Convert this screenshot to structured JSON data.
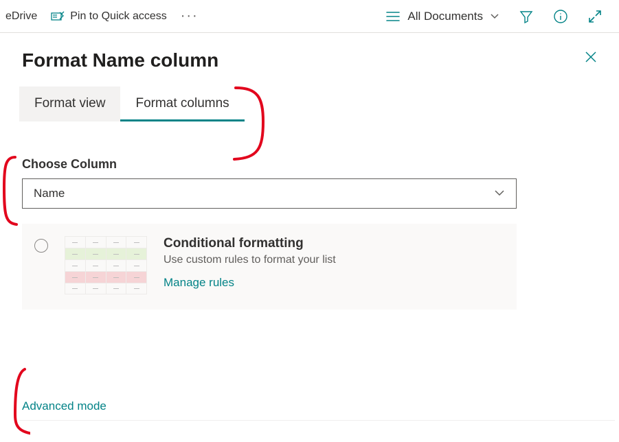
{
  "toolbar": {
    "edrive": "eDrive",
    "pin": "Pin to Quick access",
    "more": "···",
    "view": "All Documents"
  },
  "panel": {
    "title": "Format Name column",
    "tab_view": "Format view",
    "tab_columns": "Format columns",
    "choose_label": "Choose Column",
    "choose_value": "Name",
    "card_title": "Conditional formatting",
    "card_sub": "Use custom rules to format your list",
    "card_link": "Manage rules",
    "advanced": "Advanced mode"
  }
}
